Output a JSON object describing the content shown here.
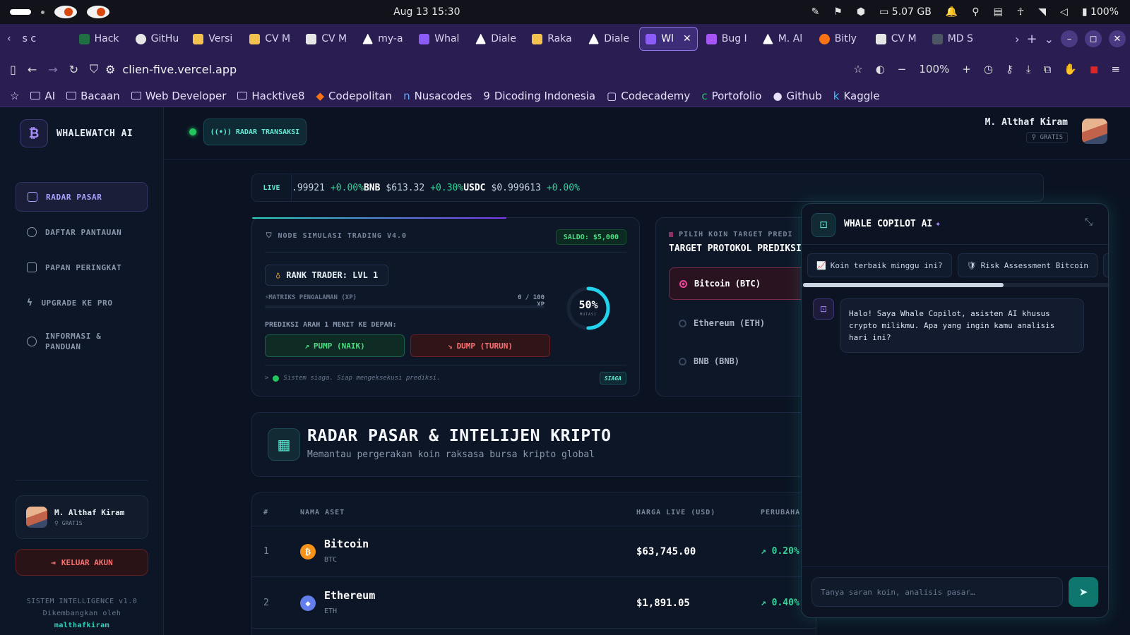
{
  "os": {
    "datetime": "Aug 13  15:30",
    "memory": "5.07 GB",
    "battery": "100%"
  },
  "browser": {
    "tabs": [
      {
        "label": "s c"
      },
      {
        "label": "Hack"
      },
      {
        "label": "GitHu"
      },
      {
        "label": "Versi"
      },
      {
        "label": "CV M"
      },
      {
        "label": "CV M"
      },
      {
        "label": "my-a"
      },
      {
        "label": "Whal"
      },
      {
        "label": "Diale"
      },
      {
        "label": "Raka"
      },
      {
        "label": "Diale"
      },
      {
        "label": "Wl"
      },
      {
        "label": "Bug I"
      },
      {
        "label": "M. Al"
      },
      {
        "label": "Bitly"
      },
      {
        "label": "CV M"
      },
      {
        "label": "MD S"
      }
    ],
    "url": "clien-five.vercel.app",
    "zoom": "100%",
    "bookmarks": [
      "AI",
      "Bacaan",
      "Web Developer",
      "Hacktive8",
      "Codepolitan",
      "Nusacodes",
      "Dicoding Indonesia",
      "Codecademy",
      "Portofolio",
      "Github",
      "Kaggle"
    ]
  },
  "sidebar": {
    "brand": "WHALEWATCH AI",
    "items": [
      {
        "label": "RADAR PASAR",
        "active": true
      },
      {
        "label": "DAFTAR PANTAUAN"
      },
      {
        "label": "PAPAN PERINGKAT"
      },
      {
        "label": "UPGRADE KE PRO"
      },
      {
        "label": "INFORMASI & PANDUAN"
      }
    ],
    "user_name": "M. Althaf Kiram",
    "user_plan": "GRATIS",
    "logout": "KELUAR AKUN",
    "footer_line1": "SISTEM INTELLIGENCE v1.0",
    "footer_line2": "Dikembangkan oleh",
    "footer_link": "malthafkiram"
  },
  "header": {
    "radar_tab": "RADAR TRANSAKSI",
    "user_name": "M. Althaf Kiram",
    "user_plan": "GRATIS"
  },
  "ticker": {
    "live": "LIVE",
    "items": [
      {
        "symbol": "",
        "price": ".99921",
        "change": "+0.00%"
      },
      {
        "symbol": "BNB",
        "price": "$613.32",
        "change": "+0.30%"
      },
      {
        "symbol": "USDC",
        "price": "$0.999613",
        "change": "+0.00%"
      }
    ]
  },
  "simulation": {
    "title": "NODE SIMULASI TRADING V4.0",
    "saldo": "SALDO: $5,000",
    "rank": "RANK TRADER: LVL 1",
    "xp_label": "MATRIKS PENGALAMAN (XP)",
    "xp_value": "0 / 100 XP",
    "xp_fraction": 0,
    "gauge_text": "50%",
    "gauge_fraction": 0.5,
    "gauge_sub": "MUTASI",
    "predict_label": "PREDIKSI ARAH 1 MENIT KE DEPAN:",
    "pump": "PUMP (NAIK)",
    "dump": "DUMP (TURUN)",
    "console": "Sistem siaga. Siap mengeksekusi prediksi.",
    "status": "SIAGA"
  },
  "target": {
    "small": "PILIH KOIN TARGET PREDI",
    "title": "TARGET PROTOKOL PREDIKSI",
    "options": [
      {
        "label": "Bitcoin (BTC)",
        "selected": true
      },
      {
        "label": "Ethereum (ETH)"
      },
      {
        "label": "BNB (BNB)"
      }
    ]
  },
  "radar": {
    "title": "RADAR PASAR & INTELIJEN KRIPTO",
    "subtitle": "Memantau pergerakan koin raksasa bursa kripto global",
    "headers": {
      "rank": "#",
      "asset": "NAMA ASET",
      "price": "HARGA LIVE (USD)",
      "change": "PERUBAHA"
    },
    "rows": [
      {
        "rank": "1",
        "name": "Bitcoin",
        "symbol": "BTC",
        "price": "$63,745.00",
        "change": "0.20%",
        "icon_color": "#f7931a",
        "icon_glyph": "₿"
      },
      {
        "rank": "2",
        "name": "Ethereum",
        "symbol": "ETH",
        "price": "$1,891.05",
        "change": "0.40%",
        "icon_color": "#627eea",
        "icon_glyph": "◆"
      }
    ]
  },
  "copilot": {
    "title": "WHALE COPILOT AI",
    "chips": [
      {
        "icon": "📈",
        "label": "Koin terbaik minggu ini?"
      },
      {
        "icon": "🛡",
        "label": "Risk Assessment Bitcoin"
      }
    ],
    "message": "Halo! Saya Whale Copilot, asisten AI khusus crypto milikmu. Apa yang ingin kamu analisis hari ini?",
    "input_placeholder": "Tanya saran koin, analisis pasar…"
  }
}
